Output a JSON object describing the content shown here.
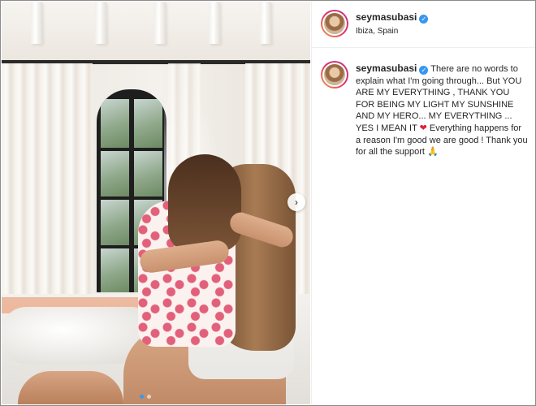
{
  "post": {
    "username": "seymasubasi",
    "verified_badge_glyph": "✓",
    "location": "Ibiza, Spain",
    "caption_text": " There are no words to explain what I'm going through... But YOU ARE MY EVERYTHING , THANK YOU FOR BEING MY LIGHT MY SUNSHINE AND MY HERO... MY EVERYTHING ... YES I MEAN IT ",
    "caption_heart": "❤",
    "caption_text_2": " Everything happens for a reason I'm good we are good ! Thank you for all the support ",
    "caption_pray": "🙏"
  },
  "media": {
    "next_arrow": "›",
    "carousel_total": 2,
    "carousel_active": 1
  },
  "colors": {
    "verified": "#3897f0",
    "heart": "#e0203a",
    "text": "#262626",
    "active_dot": "#3897f0"
  },
  "icons": {
    "verified": "verified-badge-icon",
    "next": "chevron-right-icon",
    "heart": "red-heart-icon",
    "pray": "folded-hands-icon"
  }
}
